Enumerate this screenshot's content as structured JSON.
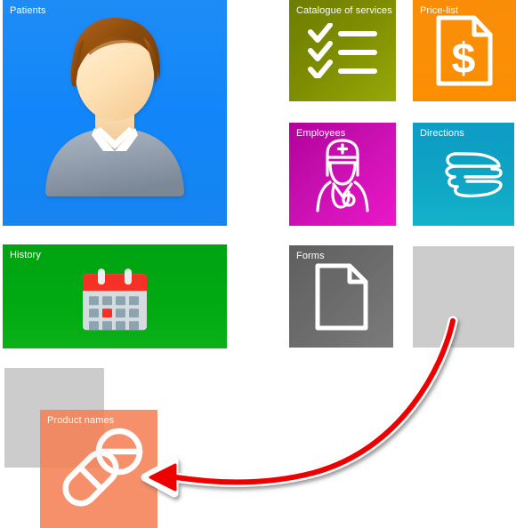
{
  "screen": {
    "title": "Tile dashboard with drag-and-drop reordering",
    "background": "#ffffff"
  },
  "tiles": [
    {
      "id": "patients",
      "label": "Patients",
      "color": "#1186fa",
      "icon": "user-avatar-icon",
      "state": "normal"
    },
    {
      "id": "catalogue",
      "label": "Catalogue of services",
      "color": "#7d8c00",
      "icon": "checklist-icon",
      "state": "normal"
    },
    {
      "id": "pricelist",
      "label": "Price-list",
      "color": "#fa8e06",
      "icon": "document-dollar-icon",
      "state": "normal"
    },
    {
      "id": "employees",
      "label": "Employees",
      "color": "#c50fae",
      "icon": "nurse-icon",
      "state": "normal"
    },
    {
      "id": "directions",
      "label": "Directions",
      "color": "#0fa3c4",
      "icon": "pointing-hand-icon",
      "state": "normal"
    },
    {
      "id": "history",
      "label": "History",
      "color": "#00a911",
      "icon": "calendar-icon",
      "state": "normal"
    },
    {
      "id": "forms",
      "label": "Forms",
      "color": "#6a6a6a",
      "icon": "document-icon",
      "state": "normal"
    },
    {
      "id": "product-names",
      "label": "Product names",
      "color": "#f58156",
      "icon": "pills-icon",
      "state": "dragging"
    }
  ],
  "placeholders": [
    {
      "id": "drop-target-right",
      "color": "#cccccc"
    },
    {
      "id": "drag-origin-slot",
      "color": "#cccccc"
    }
  ],
  "annotation": {
    "type": "curved-arrow",
    "name": "drag-direction-arrow",
    "color": "#ee0000",
    "outline": "#ffffff",
    "from": "drop-target-right",
    "to": "product-names"
  }
}
